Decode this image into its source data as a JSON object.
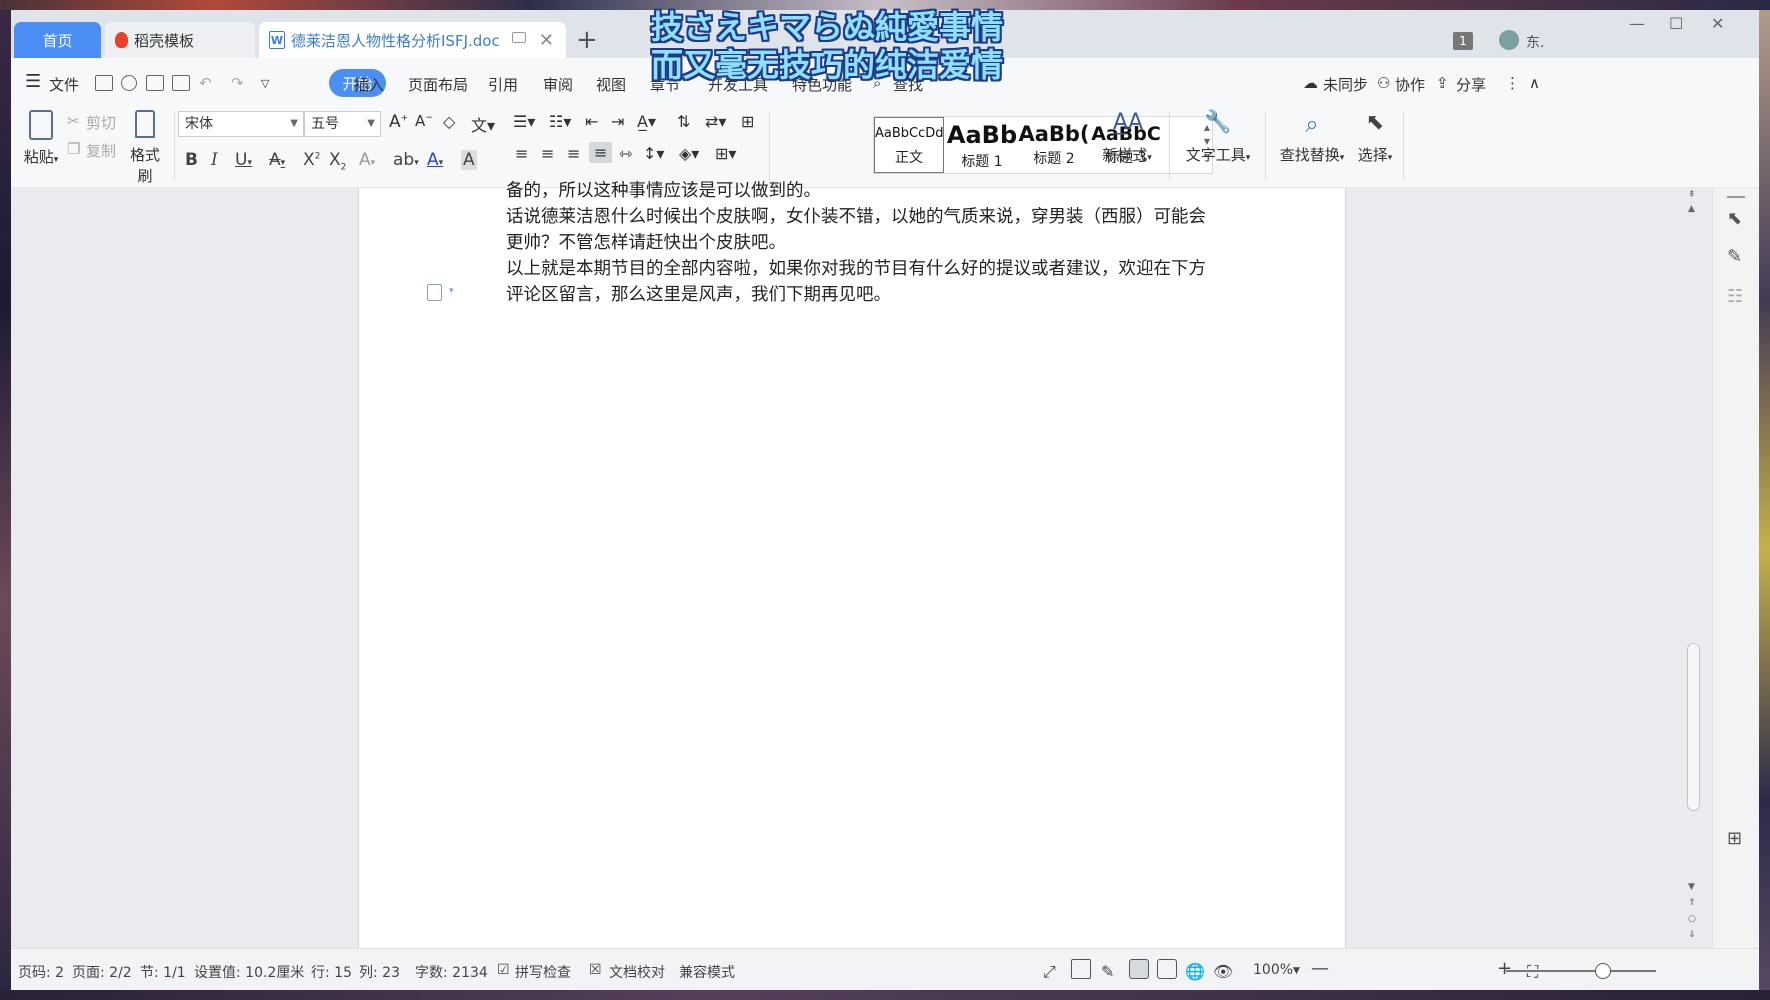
{
  "overlay": {
    "line1": "技さえキマらぬ純愛事情",
    "line2": "而又毫无技巧的纯洁爱情"
  },
  "tabs": {
    "home": "首页",
    "template": "稻壳模板",
    "document": "德莱洁恩人物性格分析ISFJ.doc",
    "add": "+"
  },
  "titlebar_right": {
    "badge": "1",
    "user": "东."
  },
  "menu": {
    "file": "文件",
    "items": [
      "开始",
      "插入",
      "页面布局",
      "引用",
      "审阅",
      "视图",
      "章节",
      "开发工具",
      "特色功能",
      "查找"
    ],
    "sync": "未同步",
    "collab": "协作",
    "share": "分享"
  },
  "ribbon": {
    "paste": "粘贴",
    "cut": "剪切",
    "copy": "复制",
    "format_painter": "格式刷",
    "font_name": "宋体",
    "font_size": "五号",
    "styles": [
      {
        "sample": "AaBbCcDd",
        "name": "正文"
      },
      {
        "sample": "AaBb",
        "name": "标题 1"
      },
      {
        "sample": "AaBb(",
        "name": "标题 2"
      },
      {
        "sample": "AaBbC",
        "name": "标题 3"
      }
    ],
    "new_style": "新样式",
    "text_tools": "文字工具",
    "find_replace": "查找替换",
    "select": "选择"
  },
  "document": {
    "paragraphs": [
      "备的，所以这种事情应该是可以做到的。",
      "话说德莱洁恩什么时候出个皮肤啊，女仆装不错，以她的气质来说，穿男装（西服）可能会更帅？不管怎样请赶快出个皮肤吧。",
      "以上就是本期节目的全部内容啦，如果你对我的节目有什么好的提议或者建议，欢迎在下方评论区留言，那么这里是风声，我们下期再见吧。"
    ]
  },
  "status": {
    "page_code": "页码: 2",
    "pages": "页面: 2/2",
    "section": "节: 1/1",
    "position": "设置值: 10.2厘米",
    "row": "行: 15",
    "col": "列: 23",
    "word_count": "字数: 2134",
    "spell_check": "拼写检查",
    "doc_proof": "文档校对",
    "compat_mode": "兼容模式",
    "zoom": "100%"
  }
}
